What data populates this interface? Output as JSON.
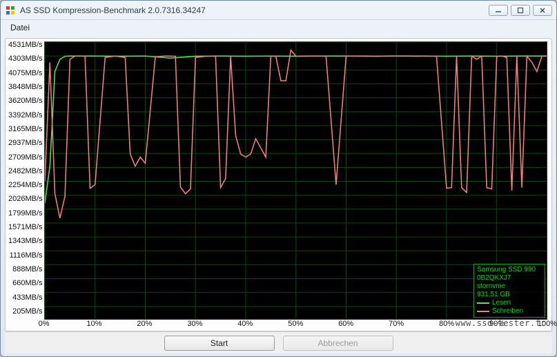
{
  "window": {
    "title": "AS SSD Kompression-Benchmark 2.0.7316.34247"
  },
  "menubar": {
    "file": "Datei"
  },
  "buttons": {
    "start": "Start",
    "cancel": "Abbrechen"
  },
  "legend": {
    "device_line1": "Samsung SSD 990",
    "device_line2": "0B2QKXJ7",
    "device_line3": "stornvme",
    "device_line4": "931,51 GB",
    "read_label": "Lesen",
    "write_label": "Schreiben",
    "read_color": "#57e257",
    "write_color": "#f48080"
  },
  "watermark": "www.ssd-tester.fr",
  "chart_data": {
    "type": "line",
    "xlabel": "",
    "ylabel": "",
    "xlim": [
      0,
      100
    ],
    "ylim": [
      0,
      4531
    ],
    "x_unit": "%",
    "y_unit": "MB/s",
    "y_ticks": [
      4531,
      4303,
      4075,
      3848,
      3620,
      3392,
      3165,
      2937,
      2709,
      2482,
      2254,
      2026,
      1799,
      1571,
      1343,
      1116,
      888,
      660,
      433,
      205
    ],
    "x_ticks": [
      0,
      10,
      20,
      30,
      40,
      50,
      60,
      70,
      80,
      90,
      100
    ],
    "x_tick_labels": [
      "0%",
      "10%",
      "20%",
      "30%",
      "40%",
      "50%",
      "60%",
      "70%",
      "80%",
      "90%",
      "100%"
    ],
    "series": [
      {
        "name": "Lesen",
        "color": "#57e257",
        "x": [
          0,
          1,
          2,
          3,
          4,
          5,
          10,
          15,
          20,
          25,
          30,
          35,
          40,
          45,
          50,
          55,
          60,
          65,
          70,
          75,
          80,
          85,
          90,
          95,
          100
        ],
        "y": [
          1900,
          2500,
          4050,
          4250,
          4300,
          4303,
          4303,
          4300,
          4303,
          4270,
          4300,
          4303,
          4300,
          4303,
          4300,
          4303,
          4303,
          4300,
          4303,
          4303,
          4300,
          4303,
          4300,
          4303,
          4303
        ]
      },
      {
        "name": "Schreiben",
        "color": "#f48080",
        "x": [
          0,
          1,
          2,
          3,
          4,
          5,
          6,
          7,
          8,
          9,
          10,
          12,
          14,
          16,
          17,
          18,
          19,
          20,
          22,
          24,
          26,
          27,
          28,
          29,
          30,
          32,
          34,
          35,
          36,
          37,
          38,
          39,
          40,
          41,
          42,
          43,
          44,
          45,
          46,
          47,
          48,
          49,
          50,
          52,
          54,
          56,
          58,
          60,
          62,
          64,
          66,
          68,
          70,
          72,
          74,
          76,
          78,
          80,
          81,
          82,
          83,
          84,
          85,
          86,
          87,
          88,
          89,
          90,
          91,
          92,
          93,
          94,
          95,
          96,
          97,
          98,
          99,
          100
        ],
        "y": [
          2254,
          4200,
          2050,
          1650,
          2010,
          4250,
          4303,
          4303,
          4300,
          2140,
          2200,
          4280,
          4303,
          4280,
          2700,
          2500,
          2650,
          2550,
          4290,
          4303,
          4300,
          2160,
          2050,
          2130,
          4280,
          4300,
          4303,
          2150,
          2300,
          4300,
          3000,
          2700,
          2650,
          2700,
          2950,
          2800,
          2650,
          4300,
          4300,
          3900,
          3900,
          4400,
          4300,
          4303,
          4303,
          4300,
          2200,
          4303,
          4303,
          4303,
          4300,
          4303,
          4303,
          4303,
          4300,
          4303,
          4300,
          2140,
          2150,
          4300,
          2150,
          2070,
          4300,
          4250,
          4303,
          2150,
          2130,
          4300,
          4303,
          4280,
          2100,
          4303,
          2150,
          4303,
          4200,
          4050,
          4303,
          4303
        ]
      }
    ]
  }
}
